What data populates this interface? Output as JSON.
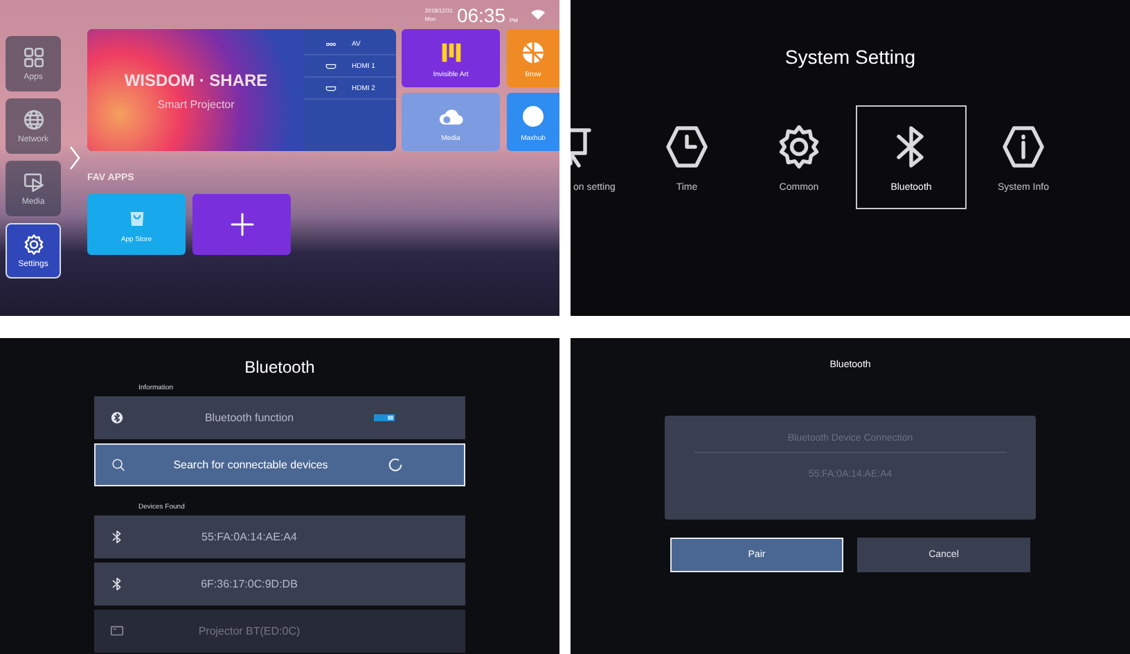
{
  "home_screen": {
    "status_bar": {
      "date": "2018/12/31",
      "day": "Mon",
      "time": "06:35",
      "meridiem": "PM"
    },
    "sidebar": {
      "items": [
        {
          "label": "Apps",
          "kind": "apps",
          "selected": false
        },
        {
          "label": "Network",
          "kind": "network",
          "selected": false
        },
        {
          "label": "Media",
          "kind": "media",
          "selected": false
        },
        {
          "label": "Settings",
          "kind": "settings",
          "selected": true
        }
      ]
    },
    "banner": {
      "title": "WISDOM · SHARE",
      "subtitle": "Smart Projector"
    },
    "inputs": [
      {
        "label": "AV",
        "kind": "av"
      },
      {
        "label": "HDMI 1",
        "kind": "hdmi"
      },
      {
        "label": "HDMI 2",
        "kind": "hdmi"
      }
    ],
    "tiles": [
      {
        "label": "Invisible Art",
        "kind": "art",
        "color": "#7a2fdc"
      },
      {
        "label": "Brow",
        "kind": "browser",
        "color": "#f08a24"
      },
      {
        "label": "Media",
        "kind": "cloud",
        "color": "#7d9be0"
      },
      {
        "label": "Maxhub",
        "kind": "maxhub",
        "color": "#2f8cf0"
      }
    ],
    "fav_apps": {
      "title": "FAV APPS",
      "items": [
        {
          "label": "App Store",
          "kind": "app_store",
          "color": "#18a8ec"
        },
        {
          "kind": "add",
          "color": "#7a2fdc"
        }
      ]
    }
  },
  "system_setting": {
    "title": "System Setting",
    "items": [
      {
        "label": "on setting",
        "kind": "projection",
        "selected": false
      },
      {
        "label": "Time",
        "kind": "time",
        "selected": false
      },
      {
        "label": "Common",
        "kind": "common",
        "selected": false
      },
      {
        "label": "Bluetooth",
        "kind": "bluetooth",
        "selected": true
      },
      {
        "label": "System Info",
        "kind": "info",
        "selected": false
      }
    ]
  },
  "bluetooth_screen": {
    "title": "Bluetooth",
    "sections": [
      {
        "heading": "Information",
        "rows": [
          {
            "label": "Bluetooth function",
            "kind": "toggle",
            "switch": {
              "on": true
            },
            "selected": false
          },
          {
            "label": "Search for connectable devices",
            "kind": "search",
            "selected": true
          }
        ]
      },
      {
        "heading": "Devices Found",
        "rows": [
          {
            "label": "55:FA:0A:14:AE:A4",
            "kind": "device",
            "selected": false
          },
          {
            "label": "6F:36:17:0C:9D:DB",
            "kind": "device",
            "selected": false
          },
          {
            "label": "Projector BT(ED:0C)",
            "kind": "projector",
            "selected": false
          }
        ]
      }
    ]
  },
  "pair_dialog": {
    "title": "Bluetooth",
    "heading": "Bluetooth Device Connection",
    "address": "55:FA:0A:14:AE:A4",
    "buttons": [
      {
        "label": "Pair",
        "selected": true
      },
      {
        "label": "Cancel",
        "selected": false
      }
    ]
  }
}
